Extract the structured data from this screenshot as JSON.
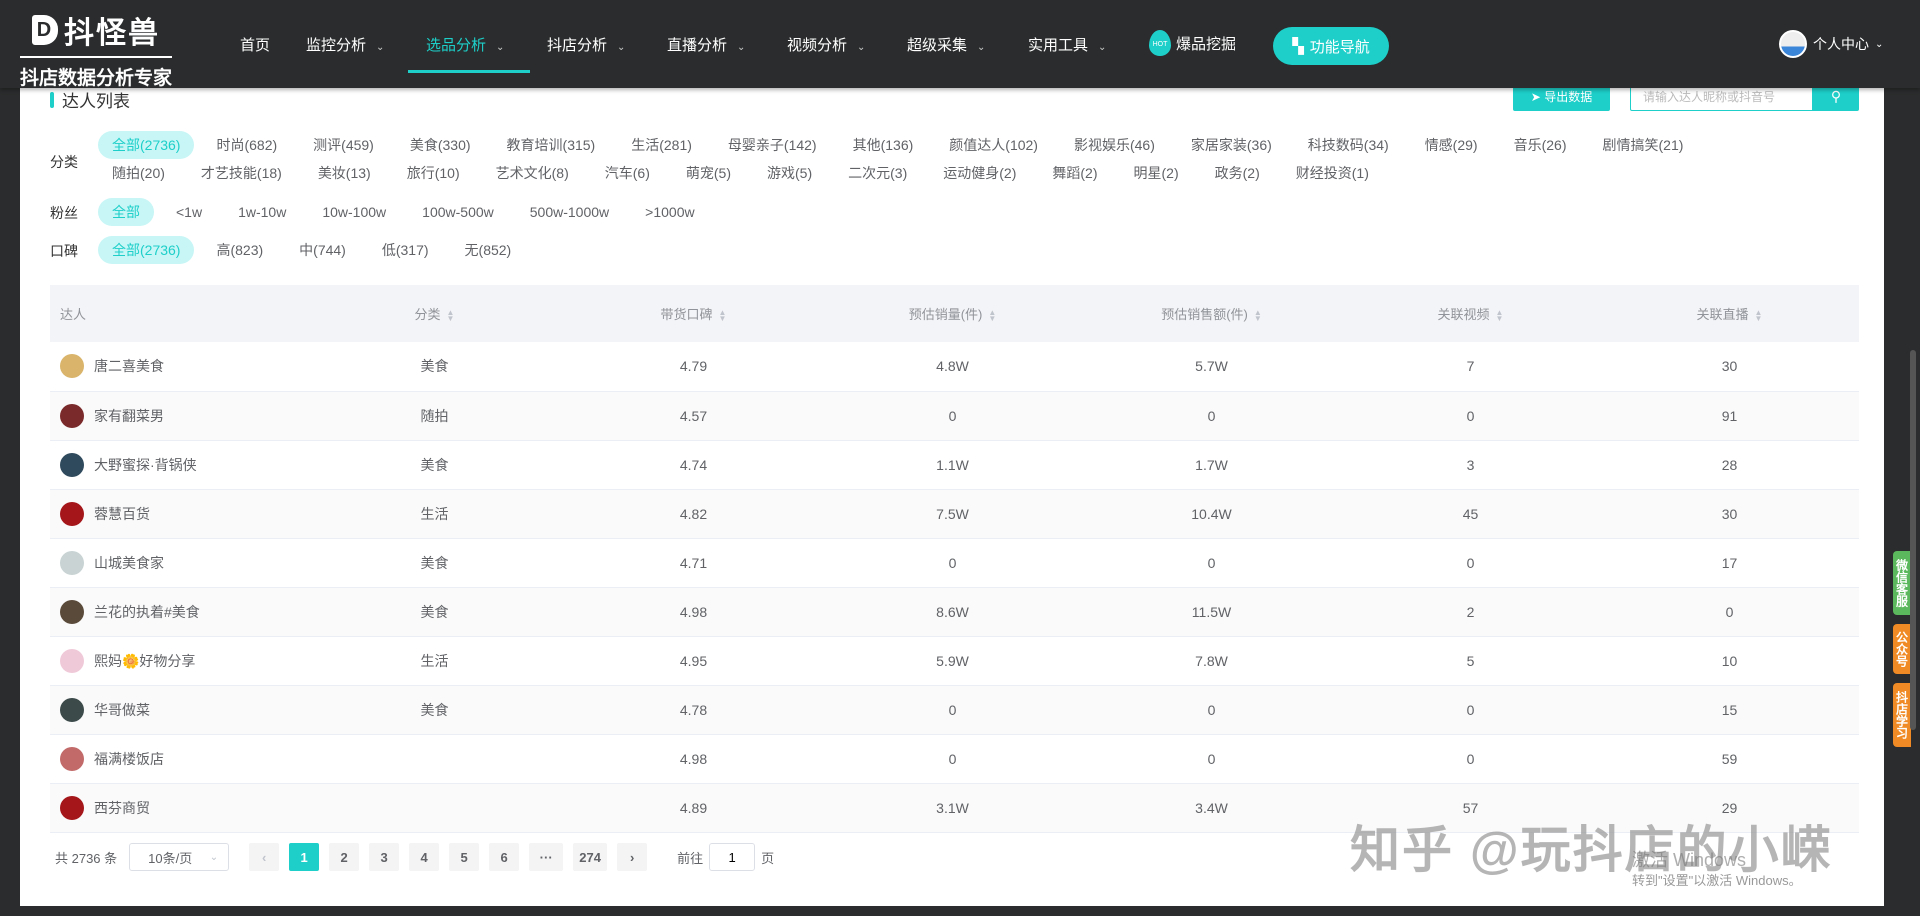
{
  "header": {
    "logo_main": "抖怪兽",
    "logo_sub": "抖店数据分析专家",
    "nav": [
      {
        "label": "首页"
      },
      {
        "label": "监控分析"
      },
      {
        "label": "选品分析"
      },
      {
        "label": "抖店分析"
      },
      {
        "label": "直播分析"
      },
      {
        "label": "视频分析"
      },
      {
        "label": "超级采集"
      },
      {
        "label": "实用工具"
      }
    ],
    "hot_badge": "HOT",
    "hot_label": "爆品挖掘",
    "func_nav": "功能导航",
    "user": "个人中心"
  },
  "page": {
    "title": "达人列表",
    "export": "导出数据",
    "search_placeholder": "请输入达人昵称或抖音号"
  },
  "filters": {
    "category_label": "分类",
    "category_rows": [
      [
        "全部(2736)",
        "时尚(682)",
        "测评(459)",
        "美食(330)",
        "教育培训(315)",
        "生活(281)",
        "母婴亲子(142)",
        "其他(136)",
        "颜值达人(102)",
        "影视娱乐(46)",
        "家居家装(36)",
        "科技数码(34)",
        "情感(29)",
        "音乐(26)",
        "剧情搞笑(21)"
      ],
      [
        "随拍(20)",
        "才艺技能(18)",
        "美妆(13)",
        "旅行(10)",
        "艺术文化(8)",
        "汽车(6)",
        "萌宠(5)",
        "游戏(5)",
        "二次元(3)",
        "运动健身(2)",
        "舞蹈(2)",
        "明星(2)",
        "政务(2)",
        "财经投资(1)"
      ]
    ],
    "fans_label": "粉丝",
    "fans": [
      "全部",
      "<1w",
      "1w-10w",
      "10w-100w",
      "100w-500w",
      "500w-1000w",
      ">1000w"
    ],
    "rep_label": "口碑",
    "rep": [
      "全部(2736)",
      "高(823)",
      "中(744)",
      "低(317)",
      "无(852)"
    ]
  },
  "table": {
    "columns": [
      "达人",
      "分类",
      "带货口碑",
      "预估销量(件)",
      "预估销售额(件)",
      "关联视频",
      "关联直播"
    ],
    "rows": [
      {
        "name": "唐二喜美食",
        "cat": "美食",
        "rep": "4.79",
        "sales": "4.8W",
        "amount": "5.7W",
        "videos": "7",
        "lives": "30",
        "color": "#d9b46a"
      },
      {
        "name": "家有翻菜男",
        "cat": "随拍",
        "rep": "4.57",
        "sales": "0",
        "amount": "0",
        "videos": "0",
        "lives": "91",
        "color": "#7a2a2a"
      },
      {
        "name": "大野蜜探·背锅侠",
        "cat": "美食",
        "rep": "4.74",
        "sales": "1.1W",
        "amount": "1.7W",
        "videos": "3",
        "lives": "28",
        "color": "#2f4a5c"
      },
      {
        "name": "蓉慧百货",
        "cat": "生活",
        "rep": "4.82",
        "sales": "7.5W",
        "amount": "10.4W",
        "videos": "45",
        "lives": "30",
        "color": "#a4161a"
      },
      {
        "name": "山城美食家",
        "cat": "美食",
        "rep": "4.71",
        "sales": "0",
        "amount": "0",
        "videos": "0",
        "lives": "17",
        "color": "#c9d3d3"
      },
      {
        "name": "兰花的执着#美食",
        "cat": "美食",
        "rep": "4.98",
        "sales": "8.6W",
        "amount": "11.5W",
        "videos": "2",
        "lives": "0",
        "color": "#5a4a3a"
      },
      {
        "name": "熙妈🌼好物分享",
        "cat": "生活",
        "rep": "4.95",
        "sales": "5.9W",
        "amount": "7.8W",
        "videos": "5",
        "lives": "10",
        "color": "#f0c9d8"
      },
      {
        "name": "华哥做菜",
        "cat": "美食",
        "rep": "4.78",
        "sales": "0",
        "amount": "0",
        "videos": "0",
        "lives": "15",
        "color": "#3c4a4a"
      },
      {
        "name": "福满楼饭店",
        "cat": "",
        "rep": "4.98",
        "sales": "0",
        "amount": "0",
        "videos": "0",
        "lives": "59",
        "color": "#c26a6a"
      },
      {
        "name": "西芬商贸",
        "cat": "",
        "rep": "4.89",
        "sales": "3.1W",
        "amount": "3.4W",
        "videos": "57",
        "lives": "29",
        "color": "#a4161a"
      }
    ]
  },
  "pagination": {
    "total": "共 2736 条",
    "page_size": "10条/页",
    "pages": [
      "1",
      "2",
      "3",
      "4",
      "5",
      "6",
      "···",
      "274"
    ],
    "current": "1",
    "goto_prefix": "前往",
    "goto_value": "1",
    "goto_suffix": "页"
  },
  "side_tabs": [
    {
      "label": "微信客服",
      "color": "#5cb85c"
    },
    {
      "label": "公众号",
      "color": "#f08a24"
    },
    {
      "label": "抖店学习",
      "color": "#f08a24"
    }
  ],
  "watermark": "知乎 @玩抖店的小嵘",
  "windows": {
    "line1": "激活 Windows",
    "line2": "转到\"设置\"以激活 Windows。"
  }
}
